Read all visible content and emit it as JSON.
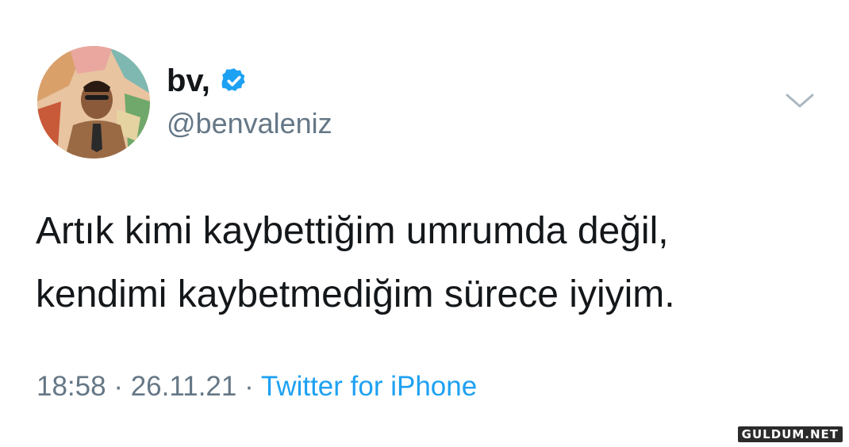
{
  "author": {
    "display_name": "bv,",
    "handle": "@benvaleniz",
    "verified": true
  },
  "tweet": {
    "lines": [
      "Artık kimi kaybettiğim umrumda değil,",
      "kendimi kaybetmediğim sürece iyiyim."
    ]
  },
  "meta": {
    "time": "18:58",
    "separator": "·",
    "date": "26.11.21",
    "source": "Twitter for iPhone"
  },
  "icons": {
    "verified": "verified-badge-icon",
    "menu": "chevron-down-icon"
  },
  "colors": {
    "text": "#14171a",
    "secondary": "#657786",
    "accent": "#1da1f2"
  },
  "watermark": {
    "text": "GULDUM.NET"
  }
}
